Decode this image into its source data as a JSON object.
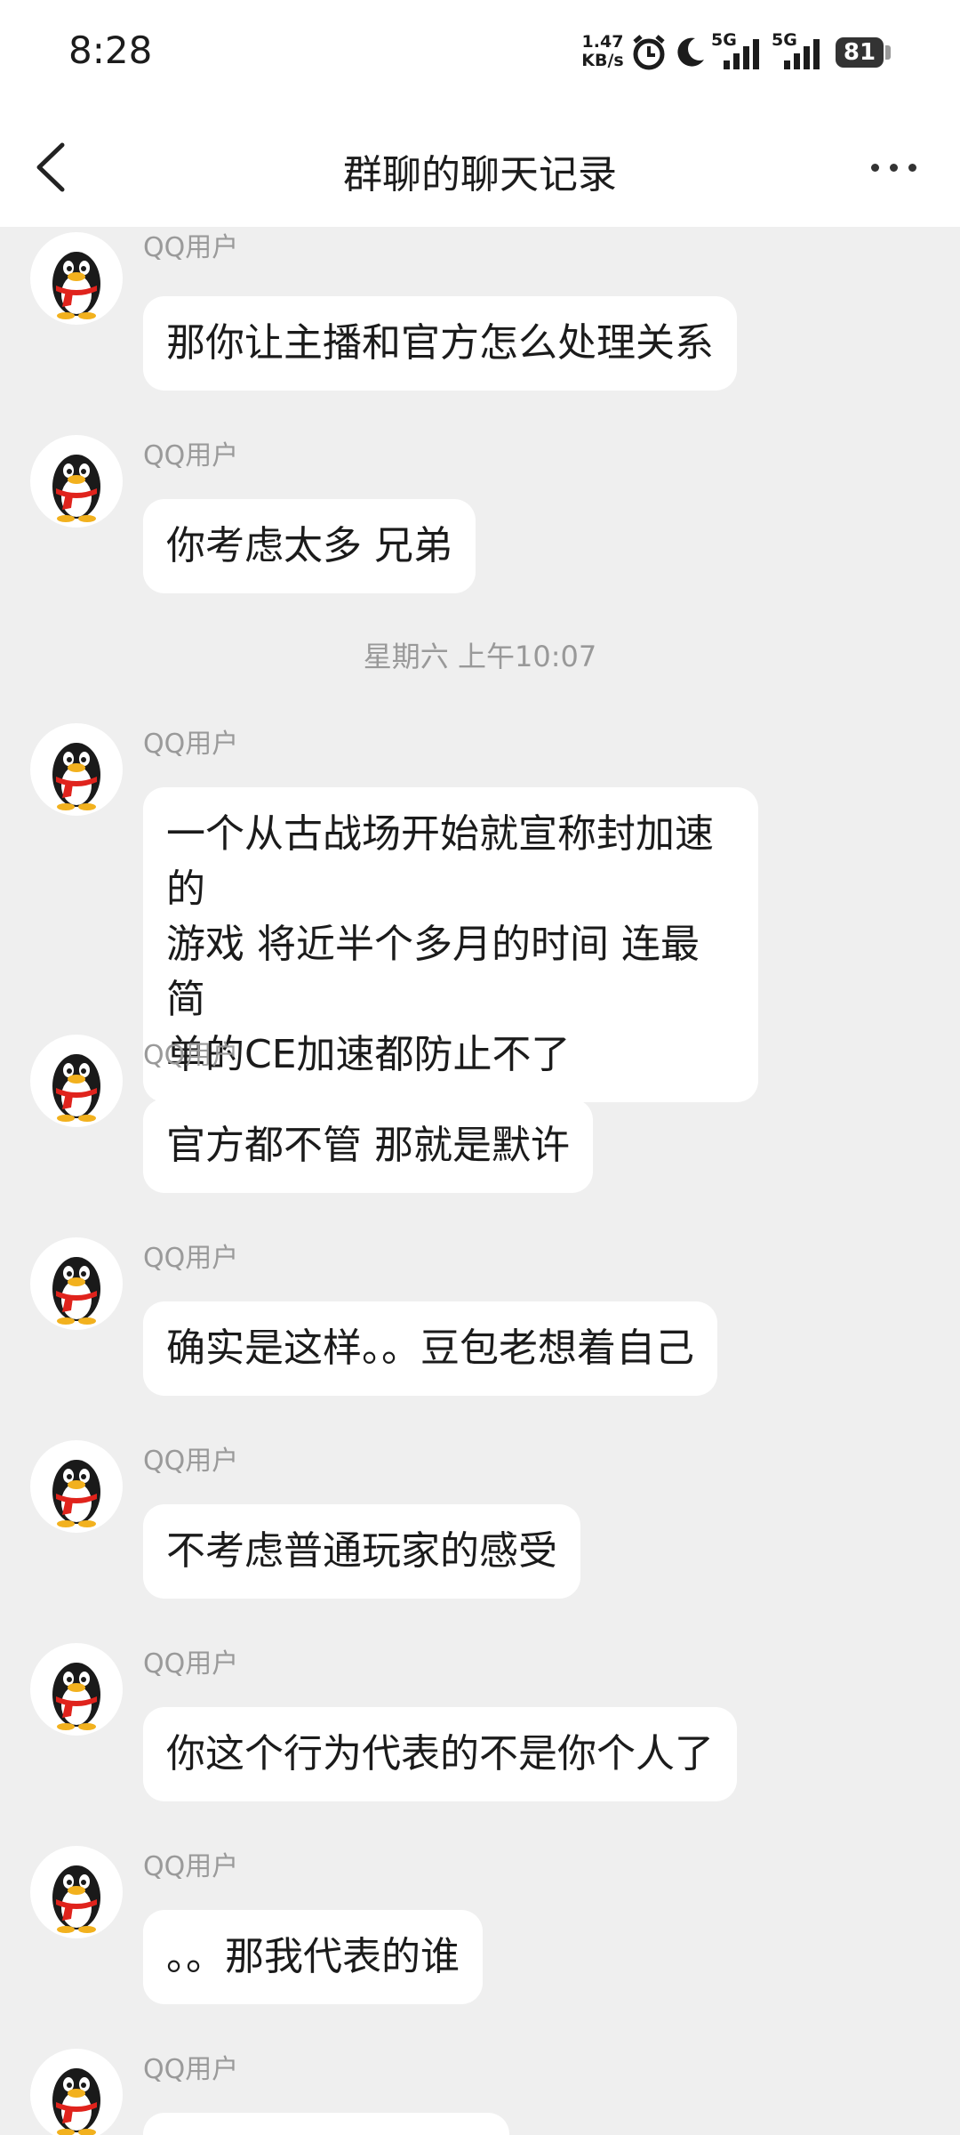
{
  "status_bar": {
    "time": "8:28",
    "net_speed_value": "1.47",
    "net_speed_unit": "KB/s",
    "sim1": "5G",
    "sim2": "5G",
    "battery": "81"
  },
  "header": {
    "title": "群聊的聊天记录"
  },
  "messages": [
    {
      "sender": "QQ用户",
      "text": "那你让主播和官方怎么处理关系"
    },
    {
      "sender": "QQ用户",
      "text": "你考虑太多 兄弟"
    },
    {
      "timestamp": "星期六 上午10:07"
    },
    {
      "sender": "QQ用户",
      "text": "一个从古战场开始就宣称封加速的\n游戏 将近半个多月的时间 连最简\n单的CE加速都防止不了"
    },
    {
      "sender": "QQ用户",
      "text": "官方都不管 那就是默许"
    },
    {
      "sender": "QQ用户",
      "text": "确实是这样。。豆包老想着自己"
    },
    {
      "sender": "QQ用户",
      "text": "不考虑普通玩家的感受"
    },
    {
      "sender": "QQ用户",
      "text": "你这个行为代表的不是你个人了"
    },
    {
      "sender": "QQ用户",
      "text": "。。那我代表的谁"
    },
    {
      "sender": "QQ用户",
      "text": ""
    }
  ],
  "colors": {
    "background": "#efefef",
    "bubble": "#ffffff",
    "sender": "#9a9a9a"
  }
}
